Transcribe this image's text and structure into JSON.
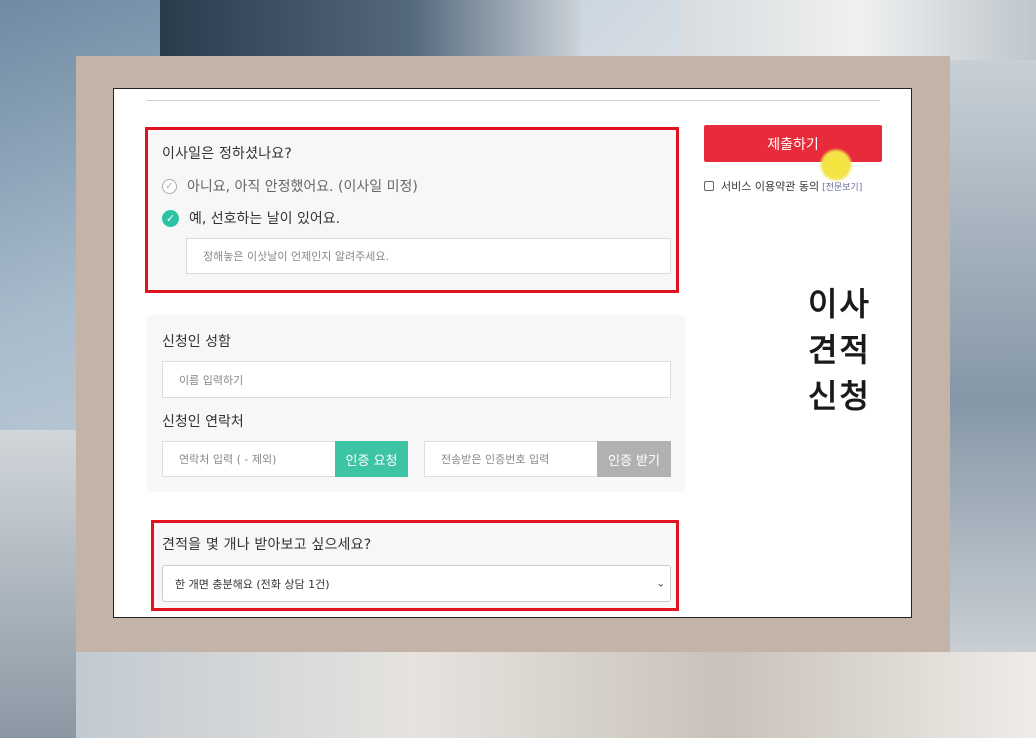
{
  "date_question": {
    "title": "이사일은 정하셨나요?",
    "option_no": "아니요, 아직 안정했어요. (이사일 미정)",
    "option_yes": "예, 선호하는 날이 있어요.",
    "date_placeholder": "정해놓은 이삿날이 언제인지 알려주세요.",
    "selected": "option_yes"
  },
  "applicant": {
    "name_label": "신청인 성함",
    "name_placeholder": "이름 입력하기",
    "contact_label": "신청인 연락처",
    "phone_placeholder": "연락처 입력 ( - 제외)",
    "request_auth_button": "인증 요청",
    "code_placeholder": "전송받은 인증번호 입력",
    "receive_auth_button": "인증 받기"
  },
  "quote_question": {
    "title": "견적을 몇 개나 받아보고 싶으세요?",
    "selected_option": "한 개면 충분해요 (전화 상담 1건)"
  },
  "submit": {
    "label": "제출하기"
  },
  "terms": {
    "text": "서비스 이용약관 동의",
    "link": "[전문보기]",
    "checked": false
  },
  "side_title": {
    "line1": "이사",
    "line2": "견적",
    "line3": "신청"
  },
  "colors": {
    "submit": "#e82b3a",
    "teal": "#3cc4a5",
    "highlight_border": "#e0141e",
    "frame": "#c4b4a7"
  },
  "icons": {
    "unchecked_radio": "check-circle-outline-icon",
    "checked_radio": "check-circle-filled-icon",
    "select_arrow": "chevron-down-icon"
  }
}
